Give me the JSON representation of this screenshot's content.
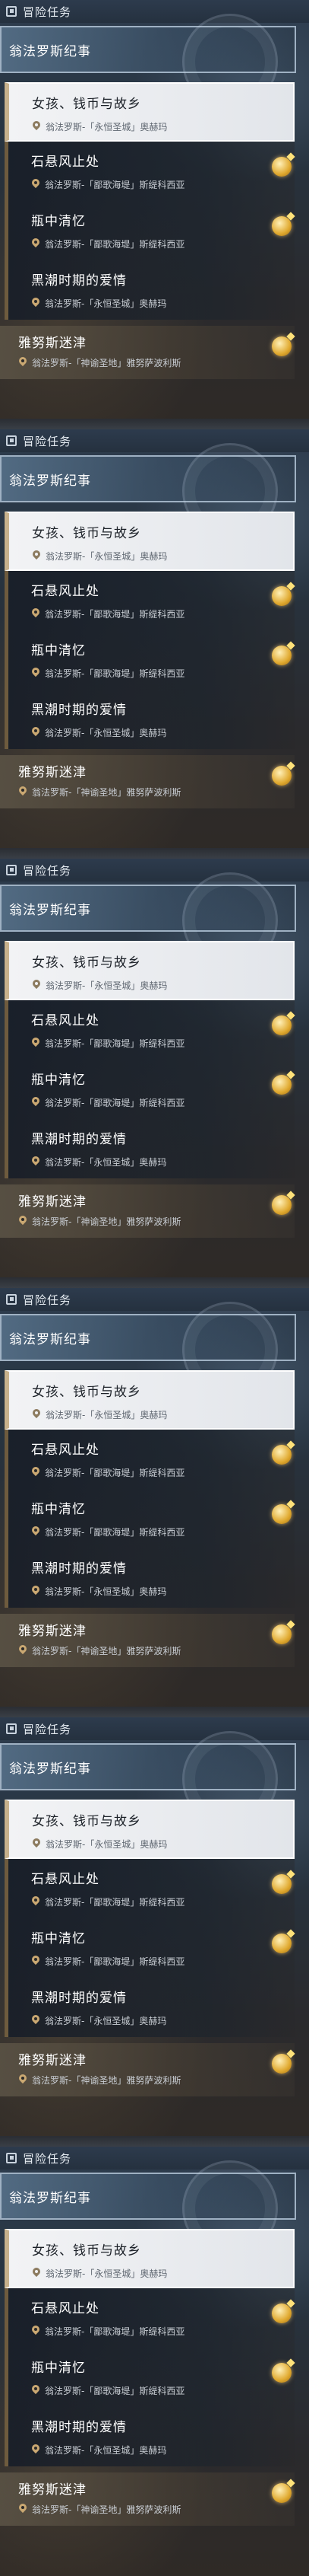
{
  "header": {
    "title": "冒险任务"
  },
  "region": {
    "title": "翁法罗斯纪事"
  },
  "quests": [
    {
      "title": "女孩、钱币与故乡",
      "location": "翁法罗斯-「永恒圣城」奥赫玛",
      "selected": true,
      "has_new_badge": false
    },
    {
      "title": "石悬风止处",
      "location": "翁法罗斯-「鄙歌海堤」斯缇科西亚",
      "selected": false,
      "has_new_badge": true
    },
    {
      "title": "瓶中清忆",
      "location": "翁法罗斯-「鄙歌海堤」斯缇科西亚",
      "selected": false,
      "has_new_badge": true
    },
    {
      "title": "黑潮时期的爱情",
      "location": "翁法罗斯-「永恒圣城」奥赫玛",
      "selected": false,
      "has_new_badge": false
    },
    {
      "title": "雅努斯迷津",
      "location": "翁法罗斯-「神谕圣地」雅努萨波利斯",
      "selected": false,
      "has_new_badge": true
    }
  ],
  "colors": {
    "accent_gold": "#caa872",
    "selected_bg": "#f2f3f5",
    "badge_gold": "#e0a92f"
  },
  "icons": {
    "header": "quest-log-icon",
    "location": "location-pin-icon",
    "new": "new-quest-badge-icon"
  }
}
